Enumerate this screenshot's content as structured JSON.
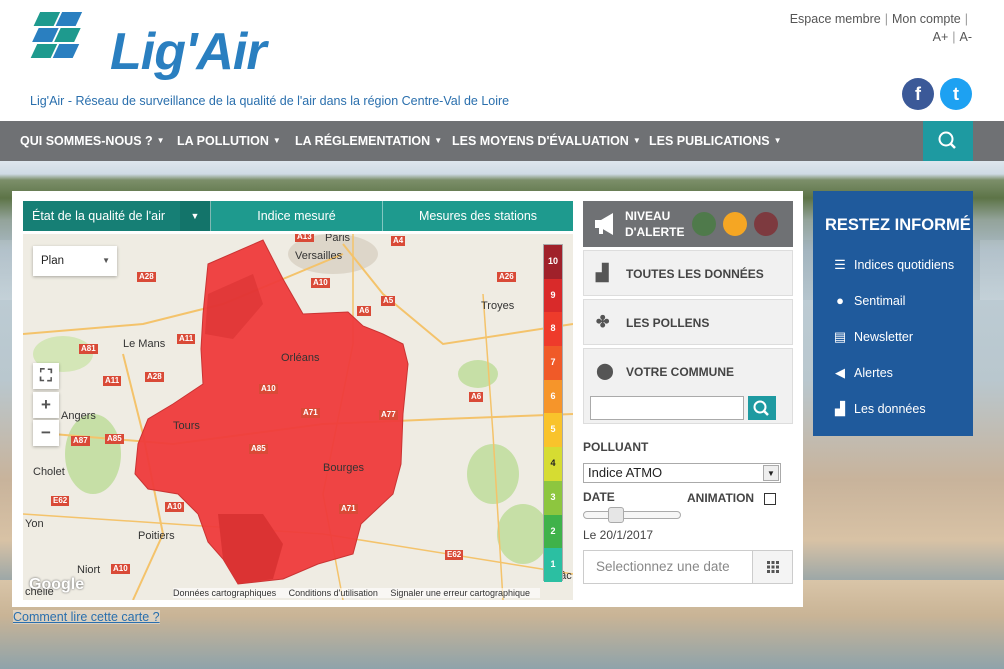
{
  "header": {
    "logo_text": "Lig'Air",
    "tagline": "Lig'Air - Réseau de surveillance de la qualité de l'air dans la région Centre-Val de Loire",
    "top_links": [
      "Espace membre",
      "Mon compte"
    ],
    "font_controls": [
      "A+",
      "A-"
    ],
    "social": [
      {
        "name": "facebook",
        "glyph": "f",
        "color": "#3b5998"
      },
      {
        "name": "twitter",
        "glyph": "t",
        "color": "#1da1f2"
      }
    ]
  },
  "nav": {
    "items": [
      "QUI SOMMES-NOUS ?",
      "LA POLLUTION",
      "LA RÉGLEMENTATION",
      "LES MOYENS D'ÉVALUATION",
      "LES PUBLICATIONS"
    ],
    "search_icon": "search-icon"
  },
  "tabs": [
    "État de la qualité de l'air",
    "Indice mesuré",
    "Mesures des stations"
  ],
  "map": {
    "map_type": "Plan",
    "controls": [
      "fullscreen-icon",
      "zoom-in",
      "zoom-out"
    ],
    "zoom_in": "+",
    "zoom_out": "−",
    "cities": [
      "Paris",
      "Versailles",
      "Troyes",
      "Le Mans",
      "Orléans",
      "Angers",
      "Tours",
      "Bourges",
      "Cholet",
      "Poitiers",
      "Niort",
      "Yon",
      "Mâc",
      "chelle"
    ],
    "roads": [
      "A13",
      "A4",
      "A28",
      "A10",
      "A5",
      "A26",
      "A11",
      "A81",
      "A6",
      "A11",
      "A28",
      "A10",
      "A6",
      "A71",
      "A77",
      "A85",
      "A85",
      "A87",
      "A71",
      "E62",
      "A10",
      "E62",
      "A10"
    ],
    "legend_levels": [
      "10",
      "9",
      "8",
      "7",
      "6",
      "5",
      "4",
      "3",
      "2",
      "1"
    ],
    "legend_colors": [
      "#a0212a",
      "#d92a2a",
      "#ee3b2b",
      "#f05a28",
      "#f6952a",
      "#f9c32b",
      "#d6dc32",
      "#8dc63f",
      "#3fb24a",
      "#2bbfa2"
    ],
    "attribution": "Google",
    "footer": [
      "Données cartographiques",
      "Conditions d'utilisation",
      "Signaler une erreur cartographique"
    ]
  },
  "help_link": "Comment lire cette carte ?",
  "side": {
    "alert_label_1": "NIVEAU",
    "alert_label_2": "D'ALERTE",
    "alert_colors": [
      "#4f7a4b",
      "#f5a623",
      "#7d3a3f"
    ],
    "all_data": "TOUTES LES DONNÉES",
    "pollens": "LES POLLENS",
    "commune": "VOTRE COMMUNE",
    "polluant_label": "POLLUANT",
    "polluant_value": "Indice ATMO",
    "date_label": "DATE",
    "animation_label": "ANIMATION",
    "date_value": "Le 20/1/2017",
    "date_placeholder": "Selectionnez une date"
  },
  "informed": {
    "title": "RESTEZ INFORMÉ",
    "items": [
      {
        "label": "Indices quotidiens",
        "icon": "list-icon"
      },
      {
        "label": "Sentimail",
        "icon": "bulb-icon"
      },
      {
        "label": "Newsletter",
        "icon": "clipboard-icon"
      },
      {
        "label": "Alertes",
        "icon": "megaphone-icon"
      },
      {
        "label": "Les données",
        "icon": "bar-chart-icon"
      }
    ]
  }
}
